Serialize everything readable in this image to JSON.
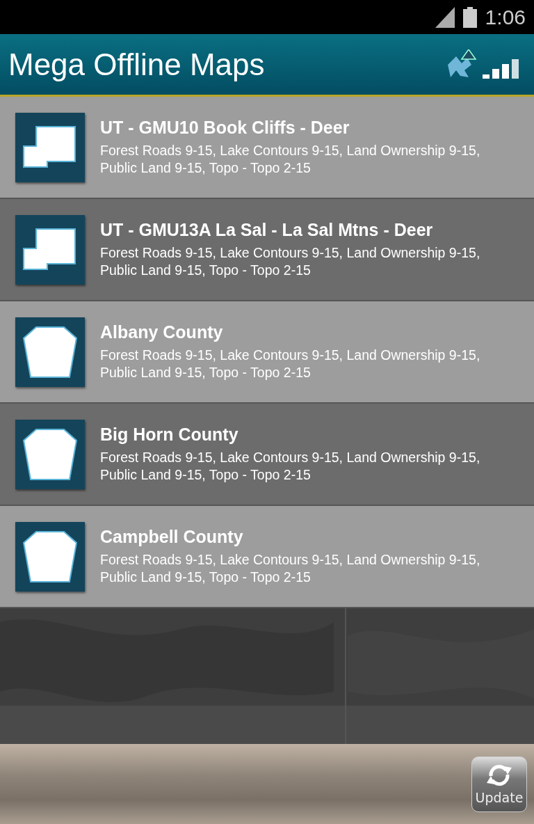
{
  "status_bar": {
    "time": "1:06"
  },
  "header": {
    "title": "Mega Offline Maps"
  },
  "maps": [
    {
      "kind": "gmu",
      "name": "UT - GMU10 Book Cliffs - Deer",
      "layers": "Forest Roads 9-15, Lake Contours 9-15, Land Ownership 9-15, Public Land 9-15, Topo - Topo 2-15"
    },
    {
      "kind": "gmu",
      "name": "UT - GMU13A La Sal - La Sal Mtns - Deer",
      "layers": "Forest Roads 9-15, Lake Contours 9-15, Land Ownership 9-15, Public Land 9-15, Topo - Topo 2-15"
    },
    {
      "kind": "county",
      "name": "Albany County",
      "layers": "Forest Roads 9-15, Lake Contours 9-15, Land Ownership 9-15, Public Land 9-15, Topo - Topo 2-15"
    },
    {
      "kind": "county",
      "name": "Big Horn County",
      "layers": "Forest Roads 9-15, Lake Contours 9-15, Land Ownership 9-15, Public Land 9-15, Topo - Topo 2-15"
    },
    {
      "kind": "county",
      "name": "Campbell County",
      "layers": "Forest Roads 9-15, Lake Contours 9-15, Land Ownership 9-15, Public Land 9-15, Topo - Topo 2-15"
    }
  ],
  "footer": {
    "update_button": "Update"
  }
}
